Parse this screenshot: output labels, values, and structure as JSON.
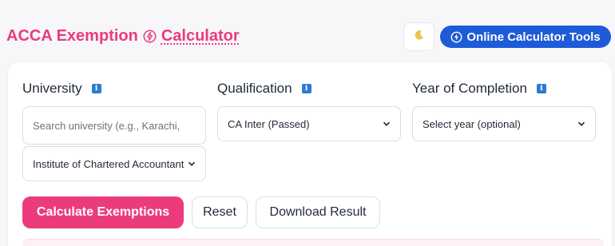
{
  "header": {
    "title_part1": "ACCA Exemption",
    "title_part2": "Calculator",
    "bolt_icon": "lightning-circle-icon",
    "theme_toggle_icon": "moon-icon",
    "tools_button_label": "Online Calculator Tools",
    "tools_button_icon": "lightning-circle-icon"
  },
  "form": {
    "university": {
      "label": "University",
      "search_placeholder": "Search university (e.g., Karachi,",
      "selected": "Institute of Chartered Accountants"
    },
    "qualification": {
      "label": "Qualification",
      "selected": "CA Inter (Passed)"
    },
    "year": {
      "label": "Year of Completion",
      "selected": "Select year (optional)"
    },
    "info_badge": "i"
  },
  "actions": {
    "calculate": "Calculate Exemptions",
    "reset": "Reset",
    "download": "Download Result"
  },
  "colors": {
    "accent": "#ec3b7c",
    "primary_blue": "#1e5bd8",
    "info_blue": "#2f7ad1"
  }
}
